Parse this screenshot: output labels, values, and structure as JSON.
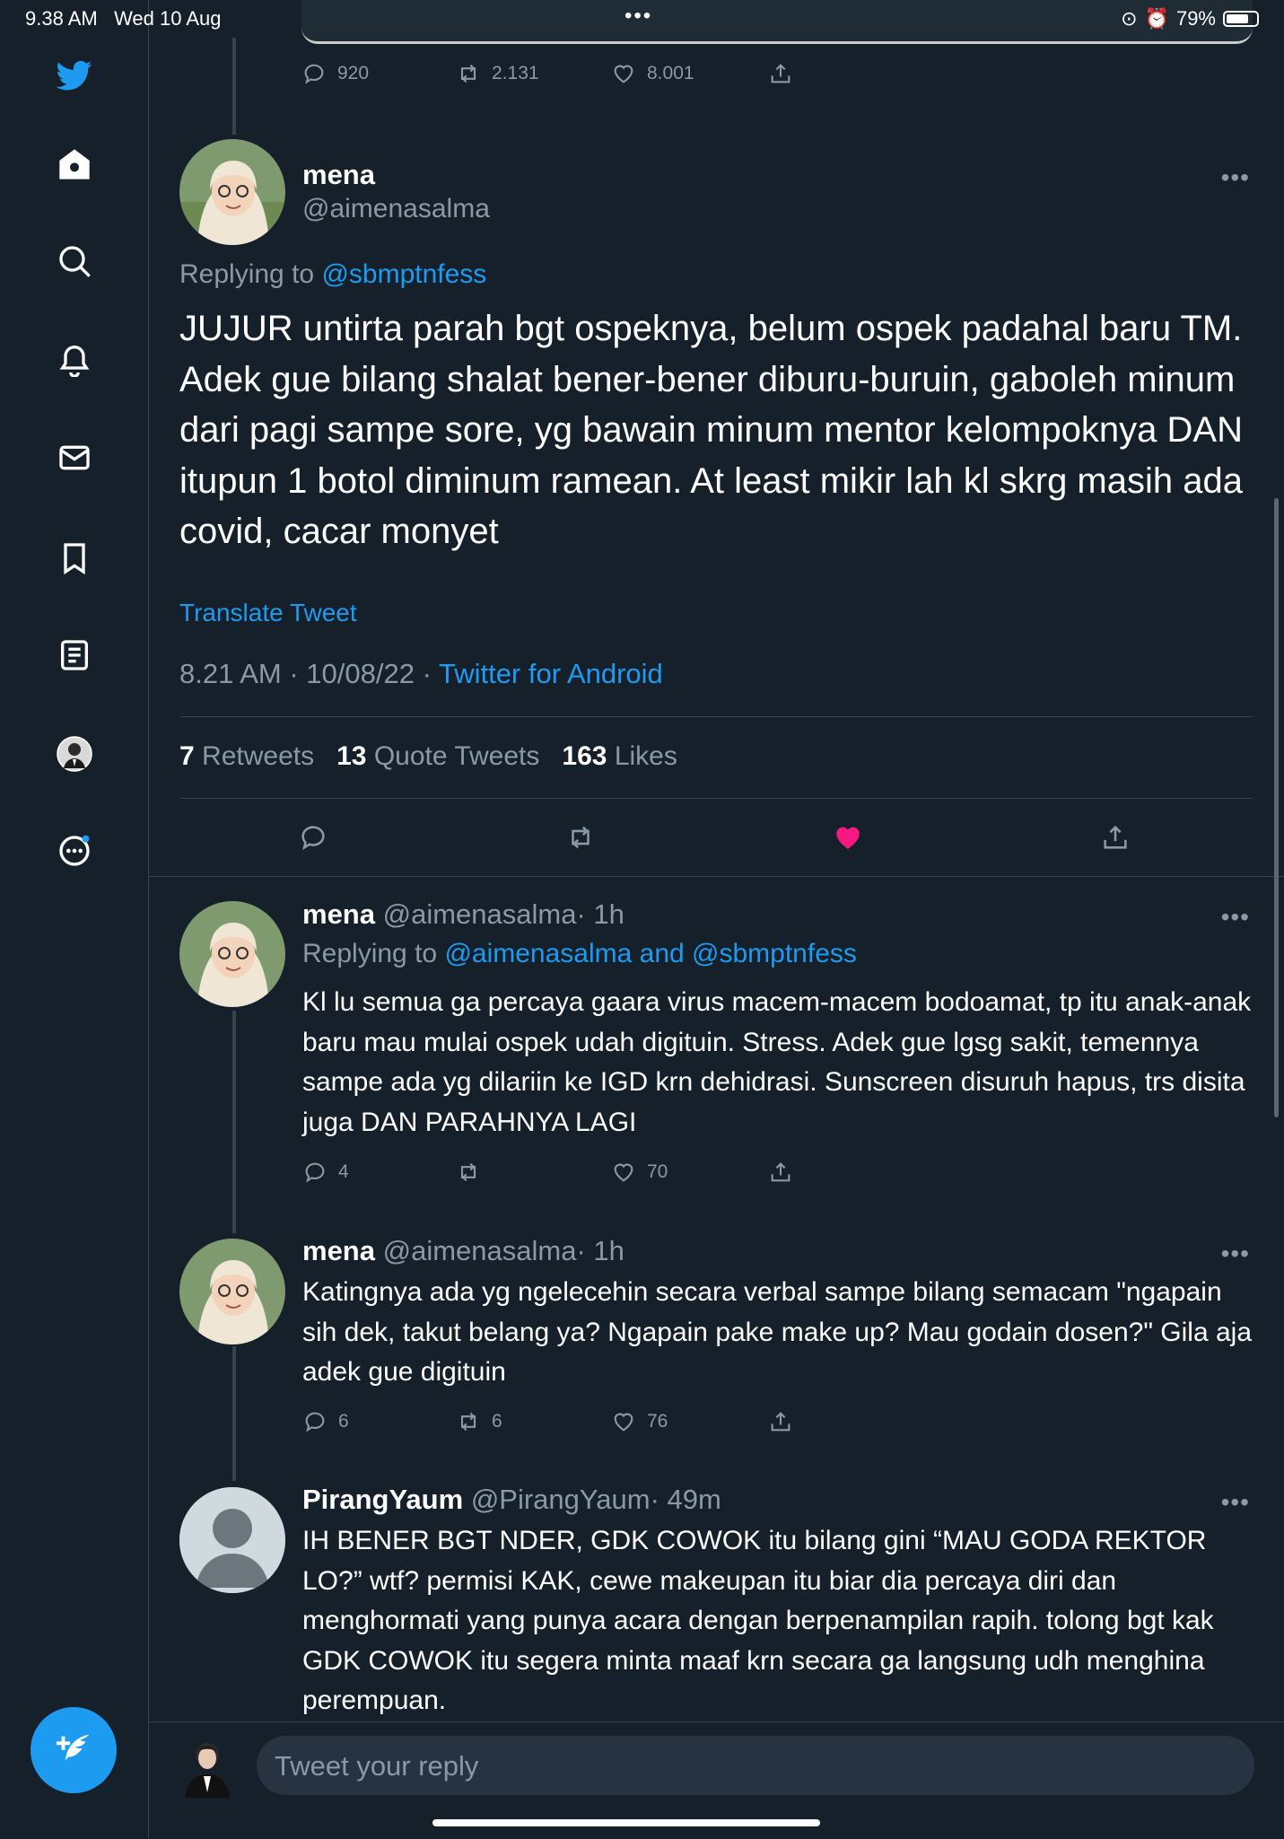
{
  "status_bar": {
    "time": "9.38 AM",
    "date": "Wed 10 Aug",
    "battery": "79%",
    "battery_level": 0.79
  },
  "sidebar": {
    "items": [
      {
        "name": "twitter-logo-icon"
      },
      {
        "name": "home-icon"
      },
      {
        "name": "explore-icon"
      },
      {
        "name": "notifications-icon"
      },
      {
        "name": "messages-icon"
      },
      {
        "name": "bookmarks-icon"
      },
      {
        "name": "lists-icon"
      },
      {
        "name": "profile-avatar"
      },
      {
        "name": "more-icon"
      }
    ],
    "compose_icon": "feather-plus-icon"
  },
  "prev_tweet_actions": {
    "replies": "920",
    "retweets": "2.131",
    "likes": "8.001"
  },
  "main_tweet": {
    "display_name": "mena",
    "handle": "@aimenasalma",
    "replying_label": "Replying to",
    "replying_to": "@sbmptnfess",
    "text": "JUJUR untirta parah bgt ospeknya, belum ospek padahal baru TM. Adek gue bilang shalat bener-bener diburu-buruin, gaboleh minum dari pagi sampe sore, yg bawain minum mentor kelompoknya DAN itupun 1 botol diminum ramean. At least mikir lah kl skrg masih ada covid, cacar monyet",
    "translate": "Translate Tweet",
    "timestamp": "8.21 AM · 10/08/22 ·",
    "source": "Twitter for Android",
    "retweets_count": "7",
    "retweets_label": "Retweets",
    "quotes_count": "13",
    "quotes_label": "Quote Tweets",
    "likes_count": "163",
    "likes_label": "Likes",
    "heart_color": "#f91880"
  },
  "replies": [
    {
      "display_name": "mena",
      "handle": "@aimenasalma",
      "time": "· 1h",
      "replying_label": "Replying to",
      "replying_to": "@aimenasalma and @sbmptnfess",
      "text": "Kl lu semua ga percaya gaara virus macem-macem bodoamat, tp itu anak-anak baru mau mulai ospek udah digituin. Stress. Adek gue lgsg sakit, temennya sampe ada yg dilariin ke IGD krn dehidrasi. Sunscreen disuruh hapus, trs disita juga DAN PARAHNYA LAGI",
      "replies": "4",
      "retweets": "",
      "likes": "70"
    },
    {
      "display_name": "mena",
      "handle": "@aimenasalma",
      "time": "· 1h",
      "text": "Katingnya ada yg ngelecehin secara verbal sampe bilang semacam \"ngapain sih dek, takut belang ya? Ngapain pake make up? Mau godain dosen?\" Gila aja adek gue digituin",
      "replies": "6",
      "retweets": "6",
      "likes": "76"
    },
    {
      "display_name": "PirangYaum",
      "handle": "@PirangYaum",
      "time": "· 49m",
      "text": "IH BENER BGT NDER, GDK COWOK itu bilang gini “MAU GODA REKTOR LO?” wtf? permisi KAK, cewe makeupan itu biar dia percaya diri dan menghormati yang punya acara dengan berpenampilan rapih. tolong bgt kak GDK COWOK itu segera minta maaf krn secara ga langsung udh menghina perempuan."
    }
  ],
  "reply_box": {
    "placeholder": "Tweet your reply"
  }
}
